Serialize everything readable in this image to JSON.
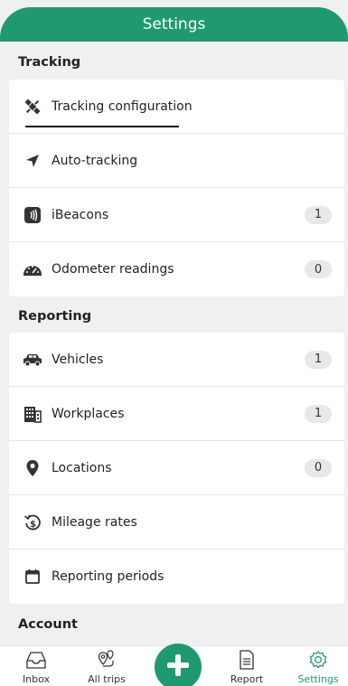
{
  "header": {
    "title": "Settings"
  },
  "colors": {
    "accent": "#1e9a6e",
    "badge_bg": "#e8e8e8",
    "background": "#f0f0f0"
  },
  "sections": {
    "tracking": {
      "title": "Tracking",
      "items": [
        {
          "label": "Tracking configuration",
          "icon": "satellite-icon"
        },
        {
          "label": "Auto-tracking",
          "icon": "navigation-arrow-icon"
        },
        {
          "label": "iBeacons",
          "icon": "beacon-icon",
          "count": "1"
        },
        {
          "label": "Odometer readings",
          "icon": "odometer-icon",
          "count": "0"
        }
      ]
    },
    "reporting": {
      "title": "Reporting",
      "items": [
        {
          "label": "Vehicles",
          "icon": "car-icon",
          "count": "1"
        },
        {
          "label": "Workplaces",
          "icon": "building-icon",
          "count": "1"
        },
        {
          "label": "Locations",
          "icon": "location-pin-icon",
          "count": "0"
        },
        {
          "label": "Mileage rates",
          "icon": "dollar-rotate-icon"
        },
        {
          "label": "Reporting periods",
          "icon": "calendar-icon"
        }
      ]
    },
    "account": {
      "title": "Account"
    }
  },
  "tabbar": {
    "items": [
      {
        "label": "Inbox",
        "icon": "inbox-icon"
      },
      {
        "label": "All trips",
        "icon": "route-pins-icon"
      },
      {
        "label": "Report",
        "icon": "document-icon"
      },
      {
        "label": "Settings",
        "icon": "gear-icon",
        "active": true
      }
    ],
    "fab_icon": "plus-icon"
  }
}
